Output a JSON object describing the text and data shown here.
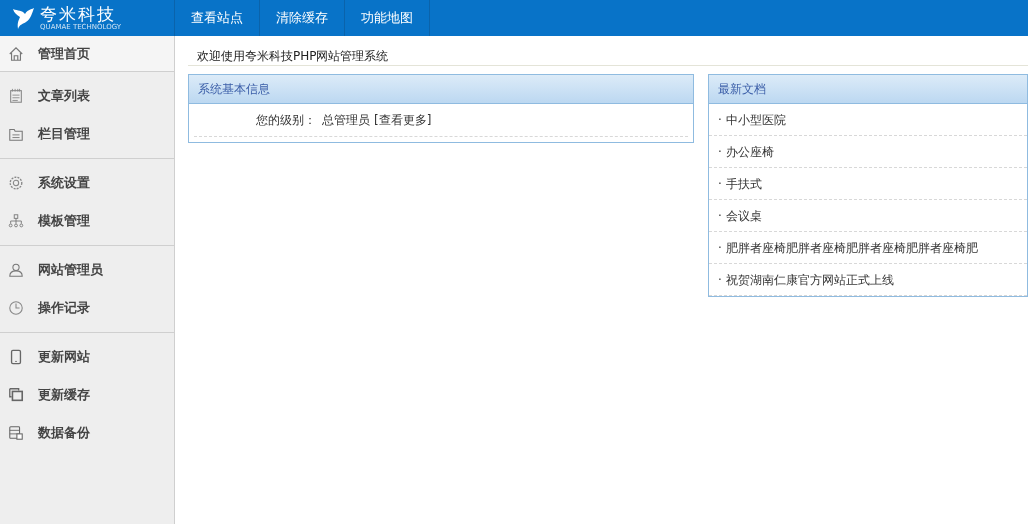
{
  "logo": {
    "name": "夸米科技",
    "tagline": "QUAMAE TECHNOLOGY"
  },
  "top_nav": [
    {
      "label": "查看站点"
    },
    {
      "label": "清除缓存"
    },
    {
      "label": "功能地图"
    }
  ],
  "sidebar": {
    "groups": [
      {
        "items": [
          {
            "label": "管理首页",
            "selected": true
          }
        ]
      },
      {
        "items": [
          {
            "label": "文章列表",
            "selected": false
          },
          {
            "label": "栏目管理",
            "selected": false
          }
        ]
      },
      {
        "items": [
          {
            "label": "系统设置",
            "selected": false
          },
          {
            "label": "模板管理",
            "selected": false
          }
        ]
      },
      {
        "items": [
          {
            "label": "网站管理员",
            "selected": false
          },
          {
            "label": "操作记录",
            "selected": false
          }
        ]
      },
      {
        "items": [
          {
            "label": "更新网站",
            "selected": false
          },
          {
            "label": "更新缓存",
            "selected": false
          },
          {
            "label": "数据备份",
            "selected": false
          }
        ]
      }
    ]
  },
  "welcome": "欢迎使用夸米科技PHP网站管理系统",
  "info_panel": {
    "title": "系统基本信息",
    "rows": [
      {
        "label": "您的级别：",
        "value": "总管理员",
        "link": "[查看更多]"
      }
    ]
  },
  "docs_panel": {
    "title": "最新文档",
    "items": [
      "· 中小型医院",
      "· 办公座椅",
      "· 手扶式",
      "· 会议桌",
      "· 肥胖者座椅肥胖者座椅肥胖者座椅肥胖者座椅肥",
      "· 祝贺湖南仁康官方网站正式上线"
    ]
  }
}
